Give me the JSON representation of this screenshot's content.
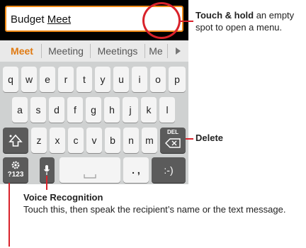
{
  "text_field": {
    "value_plain": "Budget ",
    "value_composing": "Meet"
  },
  "suggestions": {
    "items": [
      "Meet",
      "Meeting",
      "Meetings",
      "Me"
    ],
    "selected_index": 0
  },
  "keyboard": {
    "row1": [
      "q",
      "w",
      "e",
      "r",
      "t",
      "y",
      "u",
      "i",
      "o",
      "p"
    ],
    "row2": [
      "a",
      "s",
      "d",
      "f",
      "g",
      "h",
      "j",
      "k",
      "l"
    ],
    "row3": [
      "z",
      "x",
      "c",
      "v",
      "b",
      "n",
      "m"
    ],
    "shift_icon": "shift-icon",
    "del_label": "DEL",
    "symbols_label": "?123",
    "settings_icon": "gear-icon",
    "mic_icon": "microphone-icon",
    "space_icon": "space-bar-icon",
    "punct_label": ". ,",
    "smiley_label": ":-)"
  },
  "callouts": {
    "touch_hold": {
      "bold": "Touch & hold",
      "rest": " an empty spot to open a menu."
    },
    "delete": {
      "bold": "Delete"
    },
    "voice": {
      "title": "Voice Recognition",
      "body": "Touch this, then speak the recipient’s name or the text message."
    }
  },
  "colors": {
    "callout_line": "#d9222b",
    "field_border": "#f08a16",
    "selected_suggestion": "#e07a12"
  }
}
